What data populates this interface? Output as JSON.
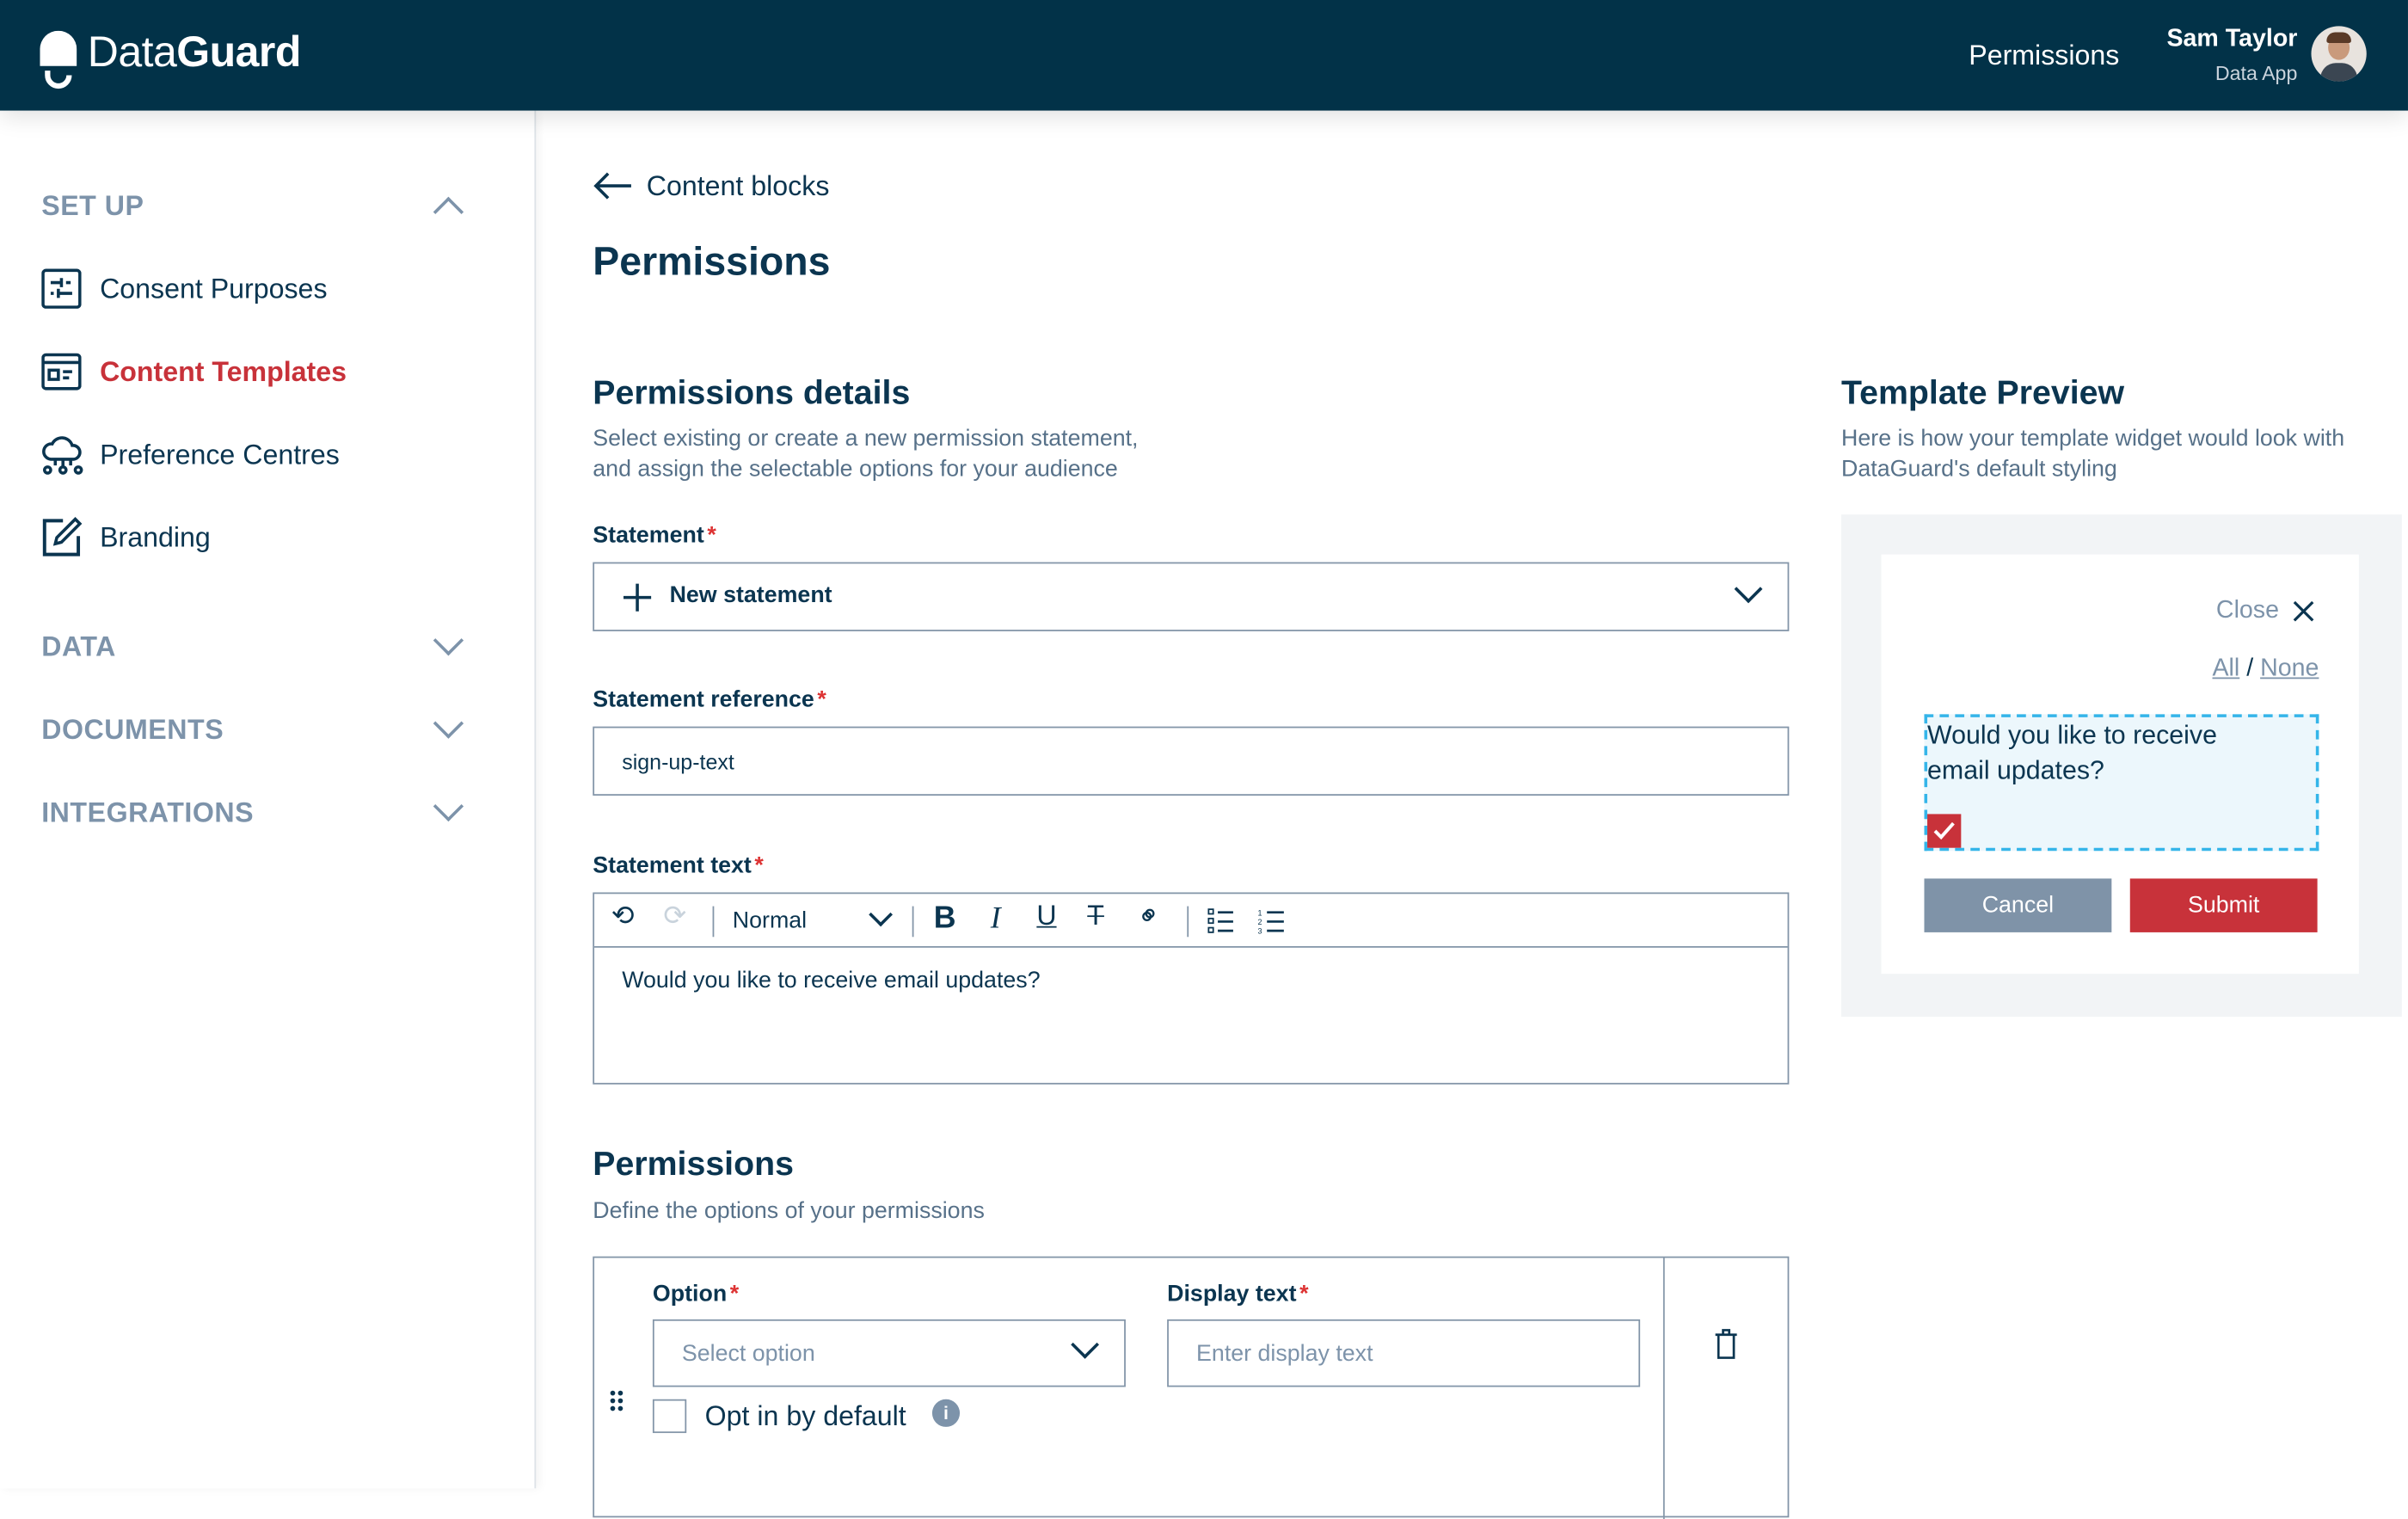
{
  "header": {
    "logo_light": "Data",
    "logo_bold": "Guard",
    "nav_link": "Permissions",
    "user_name": "Sam Taylor",
    "user_app": "Data App"
  },
  "sidebar": {
    "setup_label": "SET UP",
    "items": [
      {
        "label": "Consent Purposes",
        "icon": "sliders-icon"
      },
      {
        "label": "Content Templates",
        "icon": "template-icon",
        "active": true
      },
      {
        "label": "Preference Centres",
        "icon": "cloud-network-icon"
      },
      {
        "label": "Branding",
        "icon": "edit-brush-icon"
      }
    ],
    "sections": [
      {
        "label": "DATA"
      },
      {
        "label": "DOCUMENTS"
      },
      {
        "label": "INTEGRATIONS"
      }
    ]
  },
  "main": {
    "back_label": "Content blocks",
    "title": "Permissions",
    "details": {
      "heading": "Permissions details",
      "desc1": "Select existing or create a new permission statement,",
      "desc2": "and assign the selectable options for your audience"
    },
    "statement": {
      "label": "Statement",
      "value": "New statement"
    },
    "reference": {
      "label": "Statement reference",
      "value": "sign-up-text"
    },
    "text": {
      "label": "Statement text",
      "format": "Normal",
      "value": "Would you like to receive email updates?"
    },
    "permissions": {
      "heading": "Permissions",
      "desc": "Define the options of your permissions",
      "option_label": "Option",
      "option_placeholder": "Select option",
      "display_label": "Display text",
      "display_placeholder": "Enter display text",
      "opt_in_label": "Opt in by default",
      "opt_in_checked": false
    }
  },
  "preview": {
    "heading": "Template Preview",
    "desc1": "Here is how your template widget would look with",
    "desc2": "DataGuard's default styling",
    "close": "Close",
    "all": "All",
    "sep": "/",
    "none": "None",
    "question": "Would you like to receive email updates?",
    "checked": true,
    "cancel": "Cancel",
    "submit": "Submit"
  },
  "colors": {
    "header": "#023248",
    "accent": "#c8323a",
    "muted": "#7d93aa",
    "cancel": "#7f93a8",
    "dashed": "#35b5e9"
  }
}
